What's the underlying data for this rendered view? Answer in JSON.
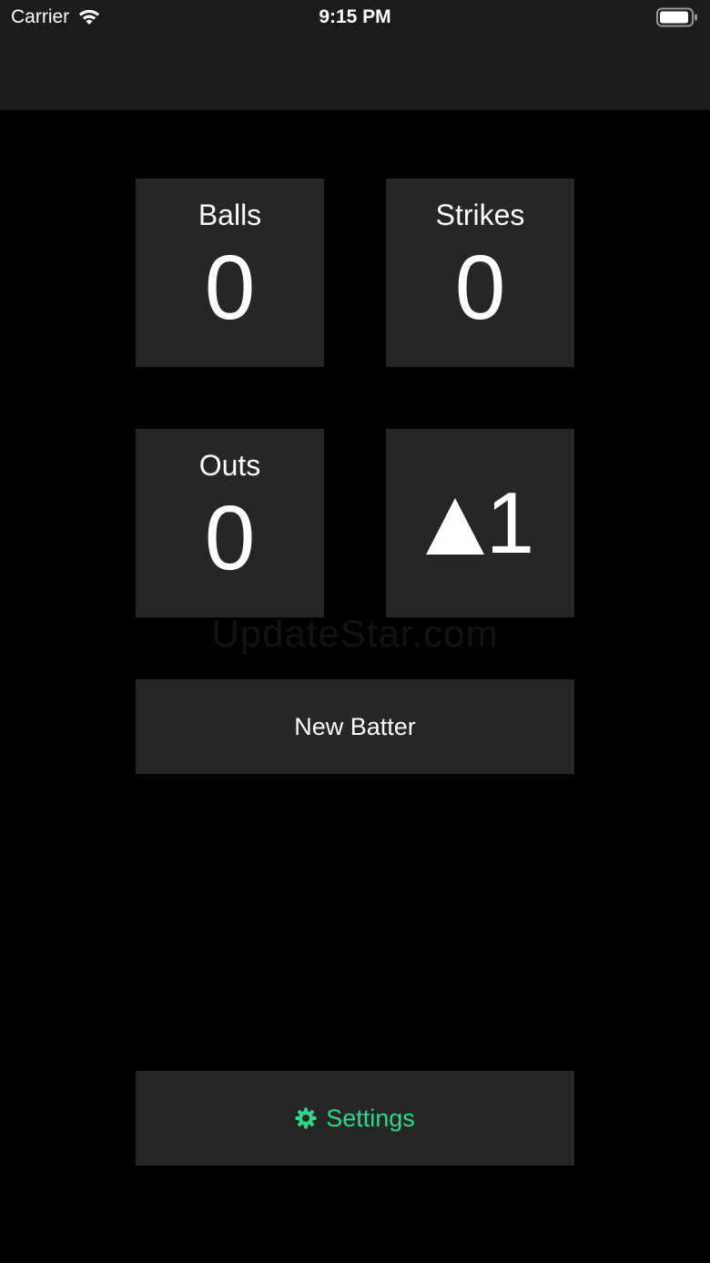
{
  "status_bar": {
    "carrier": "Carrier",
    "time": "9:15 PM"
  },
  "counters": {
    "balls": {
      "label": "Balls",
      "value": "0"
    },
    "strikes": {
      "label": "Strikes",
      "value": "0"
    },
    "outs": {
      "label": "Outs",
      "value": "0"
    },
    "inning": {
      "half": "top",
      "icon": "up-triangle-icon",
      "value": "1"
    }
  },
  "actions": {
    "new_batter_label": "New Batter",
    "settings_label": "Settings",
    "settings_icon": "gear-icon"
  },
  "watermark": "UpdateStar.com",
  "colors": {
    "background": "#000000",
    "header": "#1c1c1e",
    "tile": "#262626",
    "accent": "#2fd88a",
    "text": "#ffffff"
  }
}
